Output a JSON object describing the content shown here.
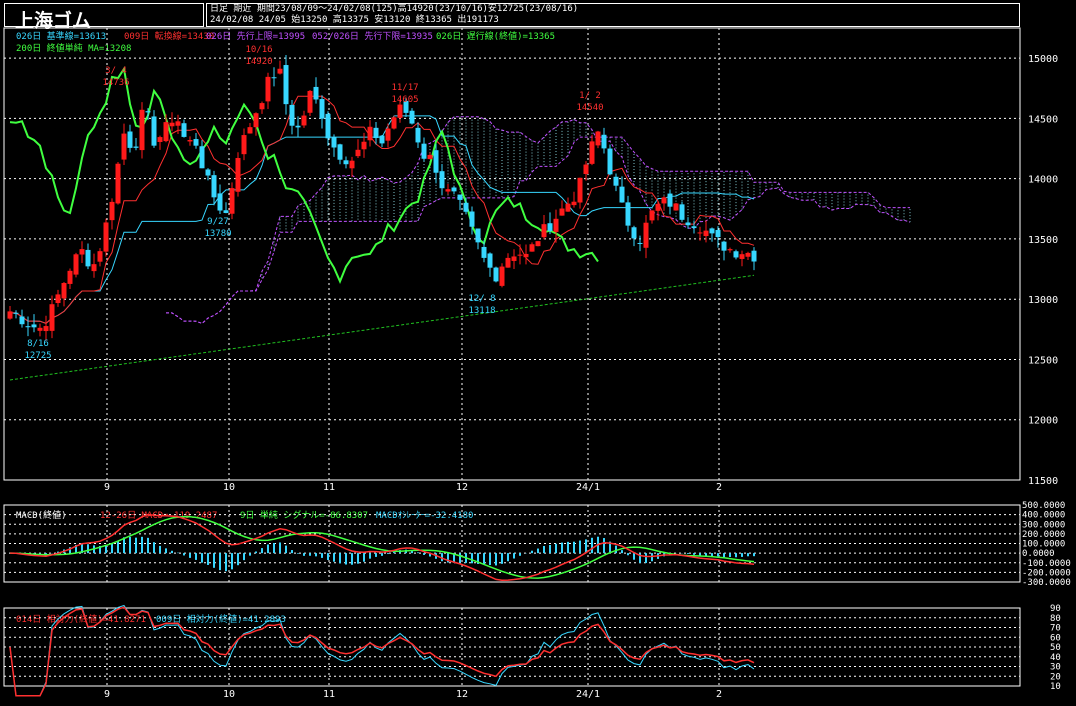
{
  "header": {
    "title": "上海ゴム",
    "info_line1": "日足 期近 期間23/08/09～24/02/08(125)高14920(23/10/16)安12725(23/08/16)",
    "info_line2": "24/02/08 24/05 始13250 高13375 安13120 終13365 出191173"
  },
  "price_legend": [
    {
      "text": "026日 基準線=13613",
      "color": "#37d7ff"
    },
    {
      "text": "009日 転換線=13430",
      "color": "#ff3030"
    },
    {
      "text": "026日 先行上限=13995",
      "color": "#c050ff"
    },
    {
      "text": "052/026日 先行下限=13935",
      "color": "#c050ff"
    },
    {
      "text": "026日 遅行線(終値)=13365",
      "color": "#40ff40"
    },
    {
      "text": "200日 終値単純 MA=13208",
      "color": "#40ff40"
    }
  ],
  "macd_legend": [
    {
      "text": "MACD(終値)",
      "color": "#ffffff"
    },
    {
      "text": "12-26日 MACD=-119.2487",
      "color": "#ff3030"
    },
    {
      "text": "9日 単純 シグナル=-86.8307",
      "color": "#40ff40"
    },
    {
      "text": "MACDｵｼﾚｰﾀｰ=-32.4180",
      "color": "#37d7ff"
    }
  ],
  "rsi_legend": [
    {
      "text": "014日 相対力(終値)=41.8271",
      "color": "#ff3030"
    },
    {
      "text": "009日 相対力(終値)=41.2893",
      "color": "#37d7ff"
    }
  ],
  "annotations": [
    {
      "date": "3/ 4",
      "value": "14736",
      "color": "#ff3030"
    },
    {
      "date": "10/16",
      "value": "14920",
      "color": "#ff3030"
    },
    {
      "date": "11/17",
      "value": "14605",
      "color": "#ff3030"
    },
    {
      "date": "1/ 2",
      "value": "14540",
      "color": "#ff3030"
    },
    {
      "date": "9/27",
      "value": "13780",
      "color": "#37d7ff"
    },
    {
      "date": "8/16",
      "value": "12725",
      "color": "#37d7ff"
    },
    {
      "date": "12/ 8",
      "value": "13118",
      "color": "#37d7ff"
    }
  ],
  "x_labels": [
    "9",
    "10",
    "11",
    "12",
    "24/1",
    "2"
  ],
  "colors": {
    "up": "#ff1a1a",
    "down": "#37d7ff",
    "grid": "#ffffff",
    "cloud": "#c050ff",
    "ma": "#20c020",
    "lagging": "#40ff40"
  },
  "chart_data": [
    {
      "type": "candlestick",
      "title": "上海ゴム",
      "period": "23/08/09～24/02/08",
      "ylim": [
        11500,
        15250
      ],
      "y_ticks": [
        11500,
        12000,
        12500,
        13000,
        13500,
        14000,
        14500,
        15000
      ],
      "x_ticks": [
        "9",
        "10",
        "11",
        "12",
        "24/1",
        "2"
      ],
      "close_waypoints": [
        12900,
        12850,
        12780,
        12760,
        12900,
        13100,
        13300,
        13400,
        13260,
        13500,
        13900,
        14380,
        14240,
        14600,
        14300,
        14400,
        14550,
        14300,
        14300,
        14000,
        13800,
        13700,
        14200,
        14400,
        14600,
        14800,
        14920,
        14500,
        14400,
        14700,
        14600,
        14300,
        14200,
        14150,
        14250,
        14400,
        14300,
        14500,
        14600,
        14450,
        14200,
        14150,
        13900,
        13850,
        13700,
        13500,
        13300,
        13200,
        13350,
        13400,
        13350,
        13500,
        13600,
        13700,
        13800,
        13900,
        14200,
        14400,
        14100,
        13800,
        13600,
        13500,
        13700,
        13800,
        13800,
        13700,
        13650,
        13600,
        13500,
        13450,
        13400,
        13400,
        13365
      ],
      "series": [
        {
          "name": "026日 基準線",
          "last": 13613
        },
        {
          "name": "009日 転換線",
          "last": 13430
        },
        {
          "name": "026日 先行上限",
          "last": 13995
        },
        {
          "name": "052/026日 先行下限",
          "last": 13935
        },
        {
          "name": "026日 遅行線(終値)",
          "last": 13365
        },
        {
          "name": "200日 終値単純 MA",
          "last": 13208
        }
      ]
    },
    {
      "type": "line",
      "title": "MACD(終値)",
      "ylim": [
        -300,
        500
      ],
      "y_ticks": [
        -300,
        -200,
        -100,
        0,
        100,
        200,
        300,
        400,
        500
      ],
      "series": [
        {
          "name": "12-26日 MACD",
          "last": -119.2487
        },
        {
          "name": "9日 単純 シグナル",
          "last": -86.8307
        },
        {
          "name": "MACDｵｼﾚｰﾀｰ",
          "last": -32.418
        }
      ]
    },
    {
      "type": "line",
      "title": "相対力(終値)",
      "ylim": [
        10,
        90
      ],
      "y_ticks": [
        10,
        20,
        30,
        40,
        50,
        60,
        70,
        80,
        90
      ],
      "series": [
        {
          "name": "014日 相対力(終値)",
          "last": 41.8271
        },
        {
          "name": "009日 相対力(終値)",
          "last": 41.2893
        }
      ]
    }
  ]
}
